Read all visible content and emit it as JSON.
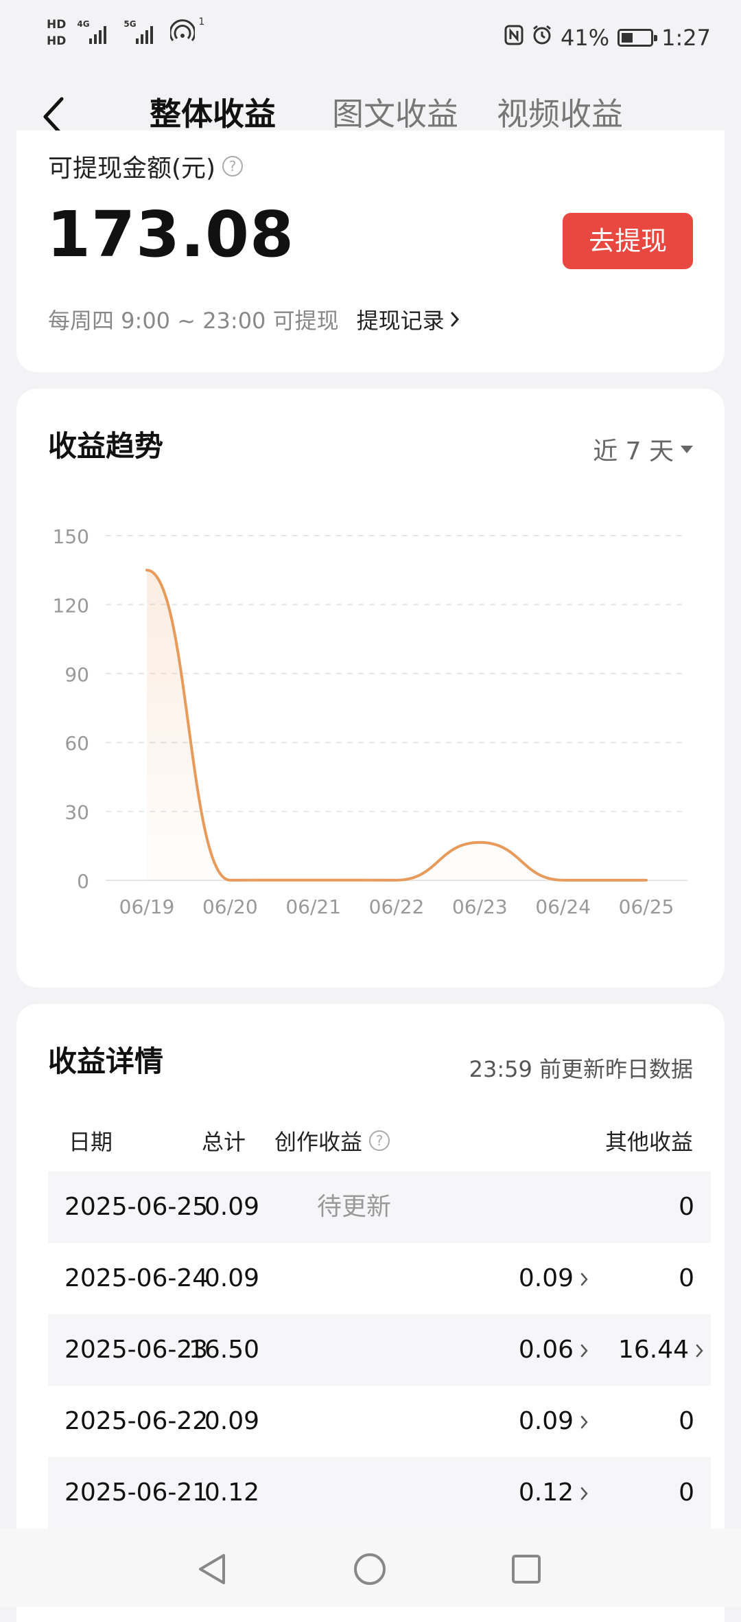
{
  "status": {
    "hd1": "HD",
    "hd2": "HD",
    "sim1_net": "4G",
    "sim2_net": "5G",
    "hotspot_count": "1",
    "battery": "41%",
    "battery_level": 0.41,
    "time": "1:27"
  },
  "header": {
    "tabs": [
      "整体收益",
      "图文收益",
      "视频收益"
    ],
    "active_tab": 0
  },
  "withdraw": {
    "label": "可提现金额(元)",
    "amount": "173.08",
    "button": "去提现",
    "schedule": "每周四 9:00 ~ 23:00 可提现",
    "record_link": "提现记录"
  },
  "trend": {
    "title": "收益趋势",
    "range": "近 7 天"
  },
  "chart_data": {
    "type": "area",
    "x": [
      "06/19",
      "06/20",
      "06/21",
      "06/22",
      "06/23",
      "06/24",
      "06/25"
    ],
    "series": [
      {
        "values": [
          135,
          0.09,
          0.12,
          0.09,
          16.5,
          0.09,
          0.09
        ]
      }
    ],
    "yticks": [
      0,
      30,
      60,
      90,
      120,
      150
    ],
    "ylim": [
      0,
      150
    ],
    "grid": true,
    "line_color": "#e89a5a"
  },
  "details": {
    "title": "收益详情",
    "update_note": "23:59 前更新昨日数据",
    "columns": [
      "日期",
      "总计",
      "创作收益",
      "其他收益"
    ],
    "rows": [
      {
        "date": "2025-06-25",
        "total": "0.09",
        "creation": "待更新",
        "other": "0"
      },
      {
        "date": "2025-06-24",
        "total": "0.09",
        "creation": "0.09",
        "other": "0"
      },
      {
        "date": "2025-06-23",
        "total": "16.50",
        "creation": "0.06",
        "other": "16.44"
      },
      {
        "date": "2025-06-22",
        "total": "0.09",
        "creation": "0.09",
        "other": "0"
      },
      {
        "date": "2025-06-21",
        "total": "0.12",
        "creation": "0.12",
        "other": "0"
      }
    ]
  }
}
